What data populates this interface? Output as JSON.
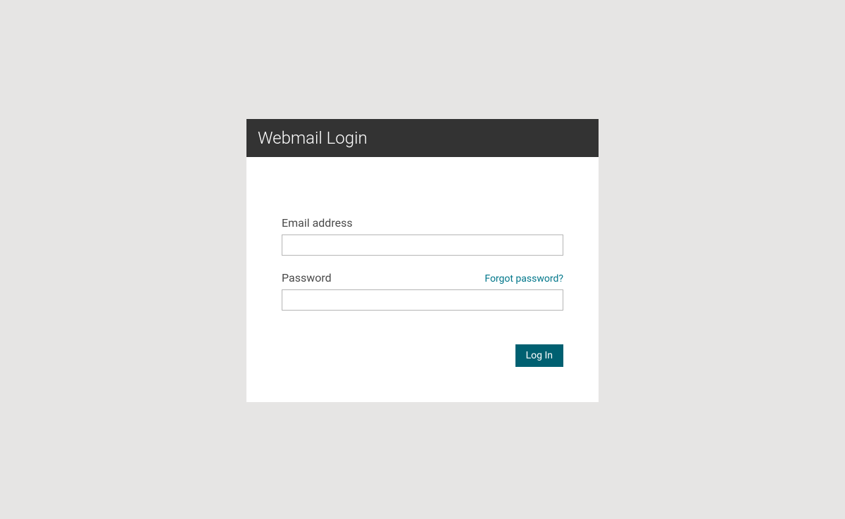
{
  "header": {
    "title": "Webmail Login"
  },
  "form": {
    "email_label": "Email address",
    "email_value": "",
    "password_label": "Password",
    "password_value": "",
    "forgot_password_label": "Forgot password?",
    "submit_label": "Log In"
  }
}
